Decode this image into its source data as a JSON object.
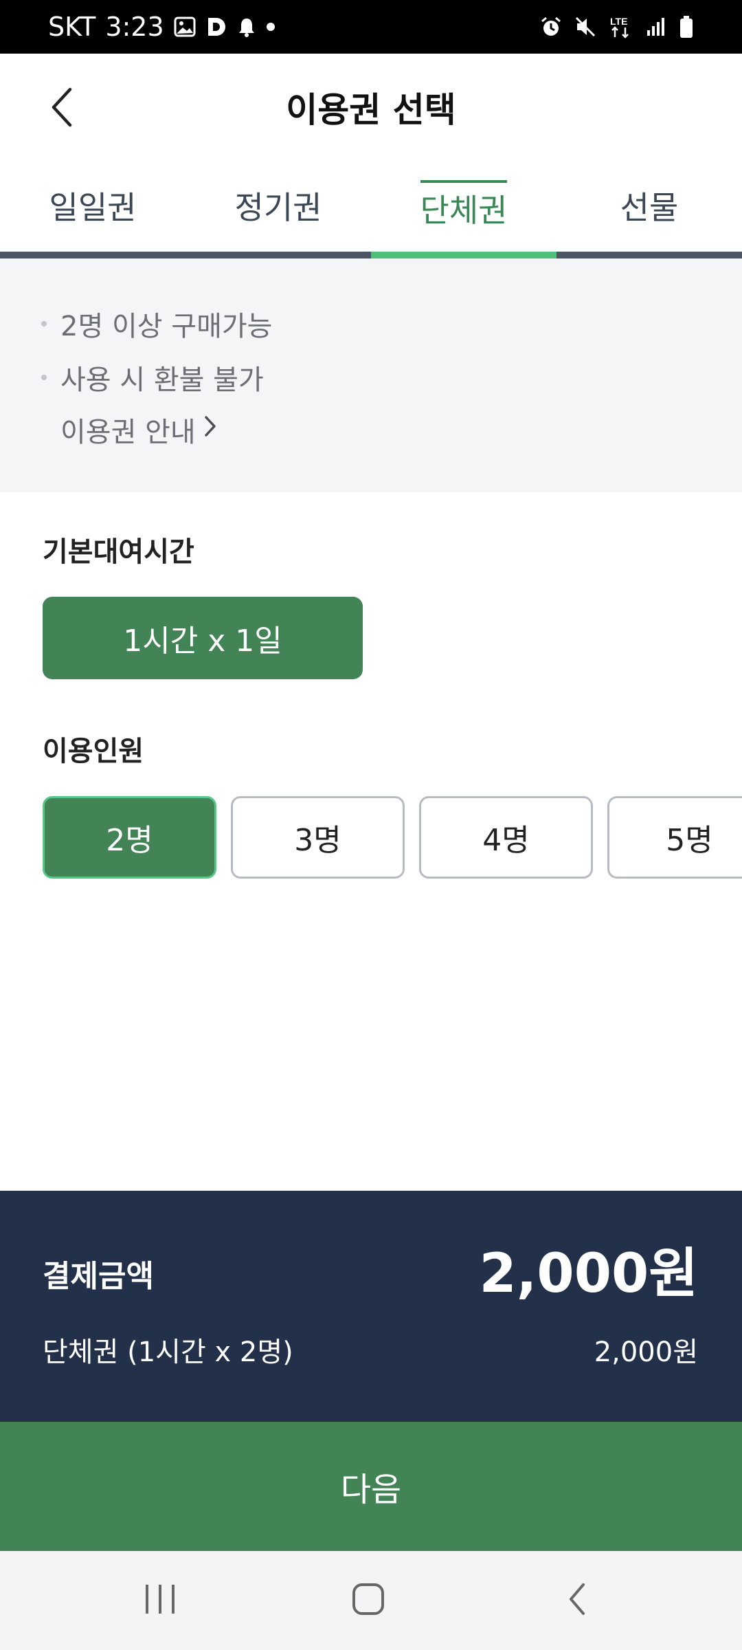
{
  "status_bar": {
    "carrier": "SKT",
    "time": "3:23",
    "left_icons": [
      "image-icon",
      "d-app-icon",
      "bell-icon",
      "dot-icon"
    ],
    "network": "LTE",
    "right_icons": [
      "alarm-icon",
      "mute-icon",
      "lte-icon",
      "signal-icon",
      "battery-icon"
    ]
  },
  "header": {
    "title": "이용권 선택",
    "back_icon": "chevron-left-icon"
  },
  "tabs": [
    {
      "label": "일일권",
      "active": false
    },
    {
      "label": "정기권",
      "active": false
    },
    {
      "label": "단체권",
      "active": true
    },
    {
      "label": "선물",
      "active": false
    }
  ],
  "info": {
    "notes": [
      "2명 이상 구매가능",
      "사용 시 환불 불가"
    ],
    "link_label": "이용권 안내"
  },
  "rental_time": {
    "title": "기본대여시간",
    "option": "1시간 x 1일"
  },
  "people": {
    "title": "이용인원",
    "options": [
      "2명",
      "3명",
      "4명",
      "5명"
    ],
    "selected": "2명"
  },
  "payment": {
    "label": "결제금액",
    "total": "2,000원",
    "description": "단체권 (1시간 x 2명)",
    "subtotal": "2,000원"
  },
  "next_button": {
    "label": "다음"
  },
  "colors": {
    "accent_green": "#428455",
    "tab_active": "#3a8655",
    "panel_navy": "#22304a"
  }
}
